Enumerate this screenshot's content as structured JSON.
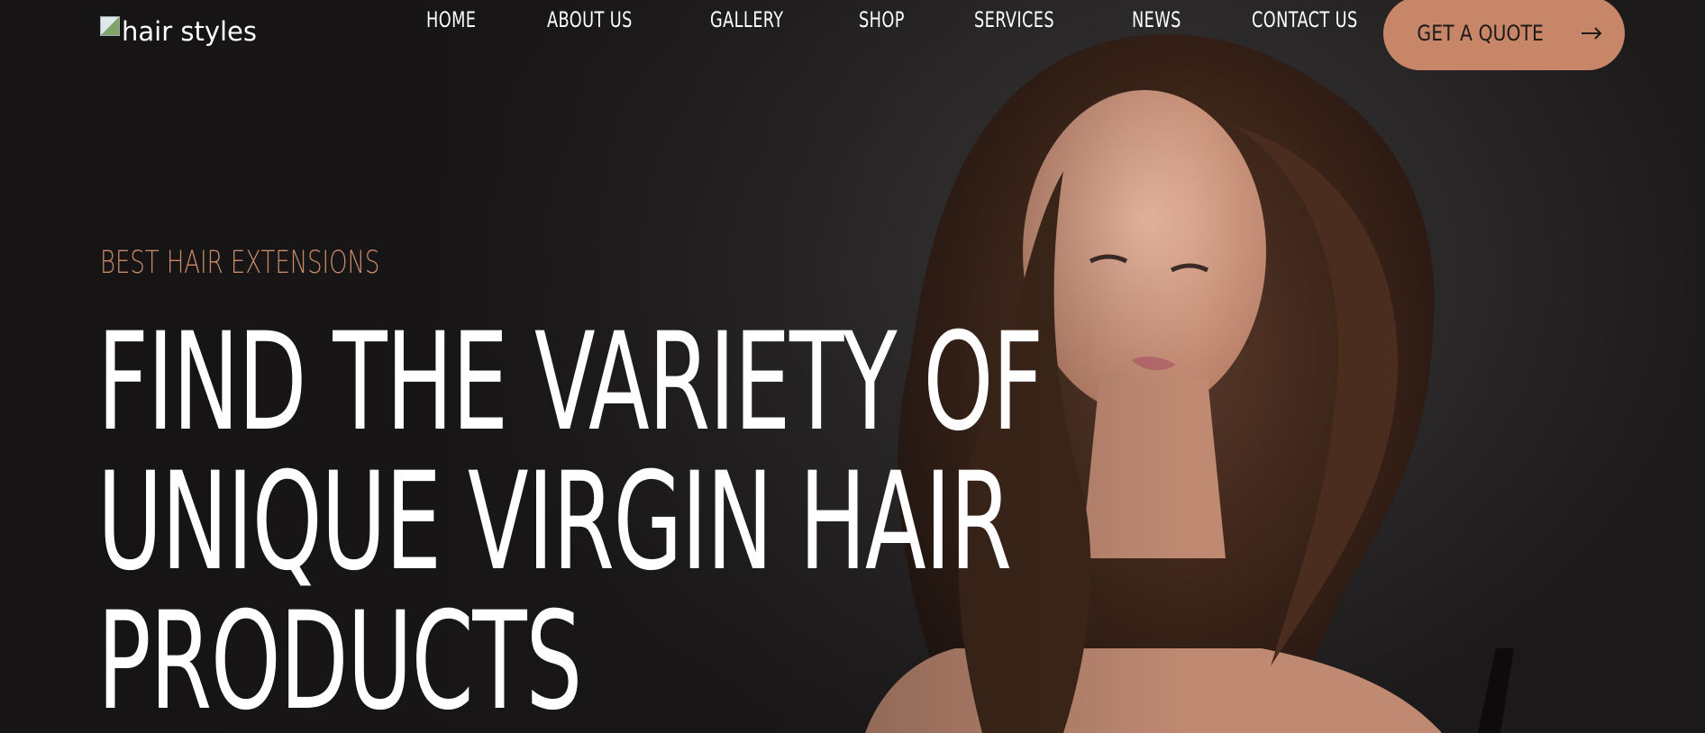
{
  "logo": {
    "alt_text": "hair styles"
  },
  "nav": {
    "items": [
      "HOME",
      "ABOUT US",
      "GALLERY",
      "SHOP",
      "SERVICES",
      "NEWS",
      "CONTACT US"
    ]
  },
  "cta": {
    "label": "GET A QUOTE",
    "icon": "arrow-right-icon"
  },
  "hero": {
    "tagline": "BEST HAIR EXTENSIONS",
    "headline_lines": [
      "FIND THE VARIETY OF",
      "UNIQUE VIRGIN HAIR",
      "PRODUCTS"
    ]
  },
  "colors": {
    "accent": "#c78668",
    "tagline": "#c98a69",
    "background": "#1c1a1a",
    "text": "#ffffff"
  }
}
